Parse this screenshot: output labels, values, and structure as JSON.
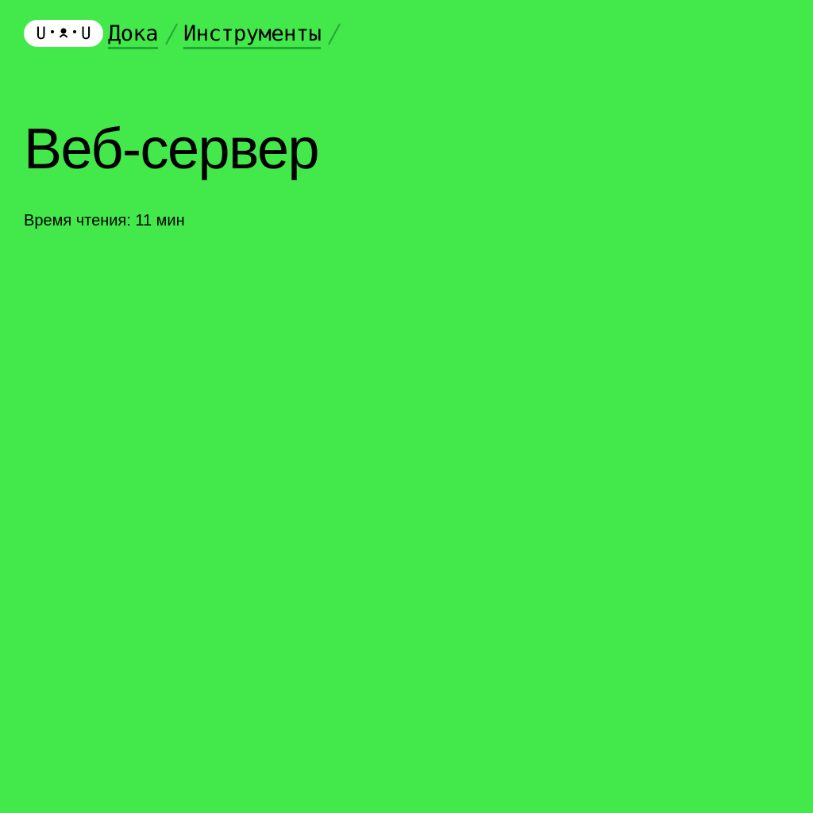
{
  "header": {
    "logo": {
      "left_glyph": "U",
      "right_glyph": "U",
      "icon": "doka-logo-face-icon"
    },
    "breadcrumbs": [
      {
        "label": "Дока"
      },
      {
        "label": "Инструменты"
      }
    ],
    "separator_icon": "slash-separator-icon"
  },
  "article": {
    "title": "Веб-сервер",
    "reading_time": "Время чтения: 11 мин"
  },
  "colors": {
    "background": "#43e84a",
    "text": "#000000",
    "link_underline": "#23a832",
    "separator": "#23a832",
    "logo_background": "#ffffff"
  }
}
